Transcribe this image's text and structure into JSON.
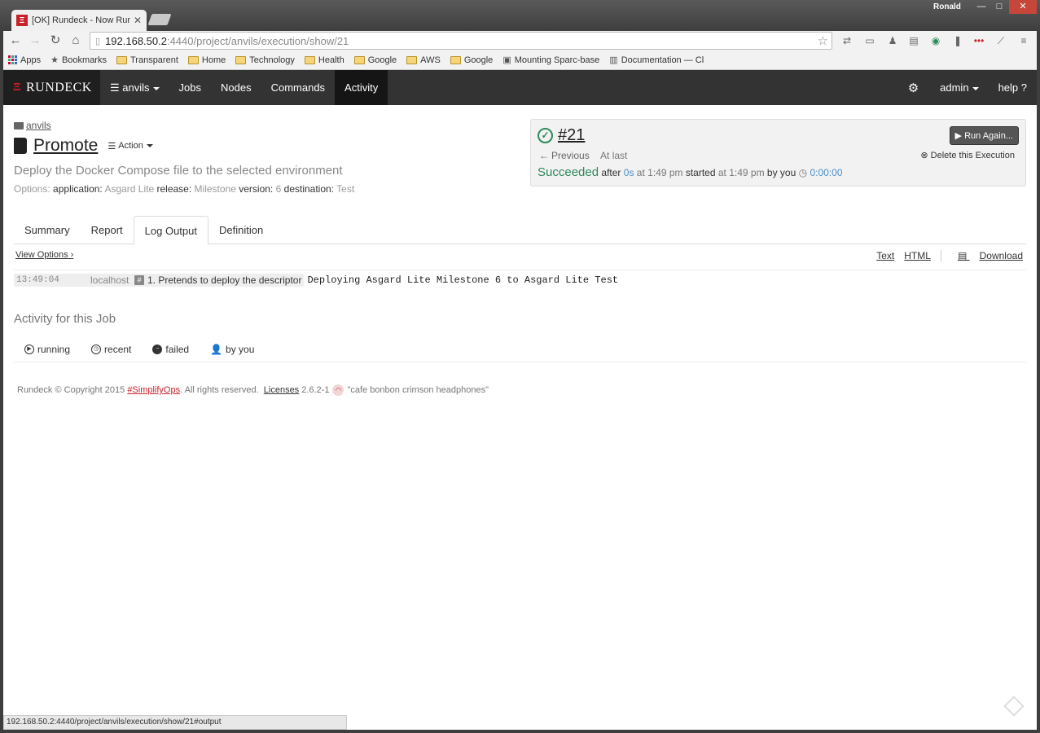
{
  "browser": {
    "tab_title": "[OK] Rundeck - Now Running",
    "tab_favicon": "rundeck-favicon",
    "user": "Ronald",
    "url_host": "192.168.50.2",
    "url_path": ":4440/project/anvils/execution/show/21",
    "bookmarks": [
      "Apps",
      "Bookmarks",
      "Transparent",
      "Home",
      "Technology",
      "Health",
      "Google",
      "AWS",
      "Google",
      "Mounting Sparc-base",
      "Documentation — Cl"
    ],
    "status_url": "192.168.50.2:4440/project/anvils/execution/show/21#output"
  },
  "nav": {
    "brand": "RUNDECK",
    "project": "anvils",
    "items": [
      "Jobs",
      "Nodes",
      "Commands",
      "Activity"
    ],
    "active": "Activity",
    "user": "admin",
    "help": "help"
  },
  "job": {
    "breadcrumb": "anvils",
    "name": "Promote",
    "action_label": "Action",
    "description": "Deploy the Docker Compose file to the selected environment",
    "options_label": "Options:",
    "options": [
      {
        "key": "application:",
        "value": "Asgard Lite"
      },
      {
        "key": "release:",
        "value": "Milestone"
      },
      {
        "key": "version:",
        "value": "6"
      },
      {
        "key": "destination:",
        "value": "Test"
      }
    ]
  },
  "execution": {
    "id": "#21",
    "previous": "Previous",
    "at_last": "At last",
    "status": "Succeeded",
    "after": "after",
    "duration_short": "0s",
    "at": "at 1:49 pm",
    "started": "started",
    "started_at": "at 1:49 pm",
    "by": "by you",
    "duration": "0:00:00",
    "run_again": "Run Again...",
    "delete": "Delete this Execution",
    "status_color": "#2d8a5a"
  },
  "tabs": [
    "Summary",
    "Report",
    "Log Output",
    "Definition"
  ],
  "active_tab": "Log Output",
  "log": {
    "view_options": "View Options",
    "text": "Text",
    "html": "HTML",
    "download": "Download",
    "lines": [
      {
        "time": "13:49:04",
        "node": "localhost",
        "step": "1. Pretends to deploy the descriptor",
        "message": "Deploying Asgard Lite Milestone 6 to Asgard Lite Test"
      }
    ]
  },
  "activity": {
    "title": "Activity for this Job",
    "tabs": [
      "running",
      "recent",
      "failed",
      "by you"
    ]
  },
  "footer": {
    "copyright": "Rundeck © Copyright 2015",
    "tag": "#SimplifyOps",
    "rights": ". All rights reserved.",
    "licenses": "Licenses",
    "version": "2.6.2-1",
    "codename": "\"cafe bonbon crimson headphones\""
  },
  "colors": {
    "brand_red": "#c9212a",
    "nav_bg": "#333333",
    "link_blue": "#4a90c8"
  }
}
